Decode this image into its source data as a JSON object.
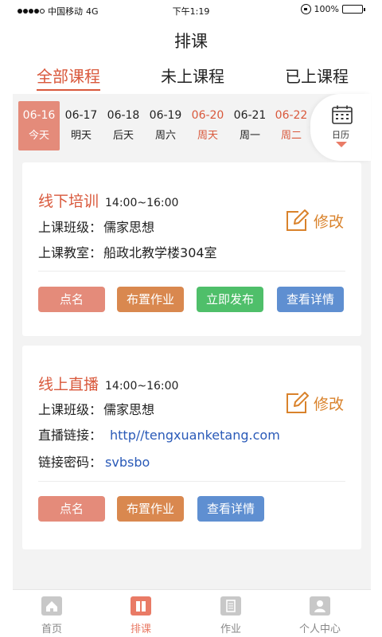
{
  "status": {
    "carrier": "中国移动",
    "network": "4G",
    "time": "下午1:19",
    "battery": "100%",
    "battery_level": 1.0
  },
  "header": {
    "title": "排课"
  },
  "tabs": [
    {
      "label": "全部课程",
      "active": true
    },
    {
      "label": "未上课程",
      "active": false
    },
    {
      "label": "已上课程",
      "active": false
    }
  ],
  "dates": [
    {
      "date": "06-16",
      "label": "今天",
      "active": true,
      "weekend": false
    },
    {
      "date": "06-17",
      "label": "明天",
      "active": false,
      "weekend": false
    },
    {
      "date": "06-18",
      "label": "后天",
      "active": false,
      "weekend": false
    },
    {
      "date": "06-19",
      "label": "周六",
      "active": false,
      "weekend": false
    },
    {
      "date": "06-20",
      "label": "周天",
      "active": false,
      "weekend": true
    },
    {
      "date": "06-21",
      "label": "周一",
      "active": false,
      "weekend": false
    },
    {
      "date": "06-22",
      "label": "周二",
      "active": false,
      "weekend": true
    }
  ],
  "calendar": {
    "label": "日历",
    "icon": "calendar-icon"
  },
  "courses": [
    {
      "name": "线下培训",
      "time": "14:00~16:00",
      "class_label": "上课班级：",
      "class_value": "儒家思想",
      "room_label": "上课教室：",
      "room_value": "船政北教学楼304室",
      "edit_label": "修改",
      "buttons": [
        "点名",
        "布置作业",
        "立即发布",
        "查看详情"
      ]
    },
    {
      "name": "线上直播",
      "time": "14:00~16:00",
      "class_label": "上课班级：",
      "class_value": "儒家思想",
      "link_label": "直播链接：",
      "link_value": "http//tengxuanketang.com",
      "pwd_label": "链接密码：",
      "pwd_value": "svbsbo",
      "edit_label": "修改",
      "buttons": [
        "点名",
        "布置作业",
        "查看详情"
      ]
    }
  ],
  "bottom_nav": [
    {
      "label": "首页",
      "icon": "home-icon",
      "active": false
    },
    {
      "label": "排课",
      "icon": "schedule-icon",
      "active": true
    },
    {
      "label": "作业",
      "icon": "homework-icon",
      "active": false
    },
    {
      "label": "个人中心",
      "icon": "profile-icon",
      "active": false
    }
  ],
  "colors": {
    "accent": "#d9583b",
    "pink_button": "#e48b7a",
    "orange_button": "#d9884f",
    "green_button": "#4fbf6a",
    "blue_button": "#5f8fd1",
    "link": "#2a5ab8",
    "edit": "#d9822b"
  }
}
